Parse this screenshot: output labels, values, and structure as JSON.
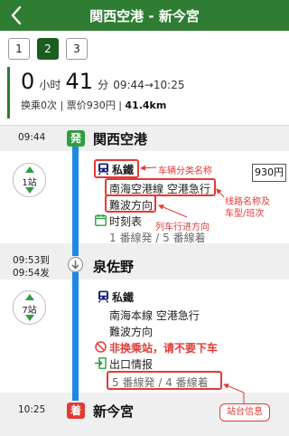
{
  "header": {
    "title": "関西空港 - 新今宮",
    "back_icon": "chevron-left-icon"
  },
  "route_pages": [
    {
      "label": "1",
      "selected": false
    },
    {
      "label": "2",
      "selected": true
    },
    {
      "label": "3",
      "selected": false
    }
  ],
  "summary": {
    "hours": "0",
    "hours_unit": "小时",
    "minutes": "41",
    "minutes_unit": "分",
    "depart_time": "09:44",
    "arrow": "→",
    "arrive_time": "10:25",
    "transfers": "换乘0次",
    "sep1": " | ",
    "fare": "票价930円",
    "sep2": " | ",
    "distance": "41.4km"
  },
  "stations": {
    "origin": {
      "time": "09:44",
      "badge": "発",
      "name": "関西空港"
    },
    "middle": {
      "time_arr": "09:53到",
      "time_dep": "09:54发",
      "name": "泉佐野"
    },
    "dest": {
      "time": "10:25",
      "badge": "着",
      "name": "新今宮"
    }
  },
  "segment1": {
    "stops": "1站",
    "category": "私鐵",
    "line_name": "南海空港線 空港急行",
    "direction": "難波方向",
    "timetable": "时刻表",
    "platform": "1 番線発 / 5 番線着",
    "fare": "930円"
  },
  "segment2": {
    "stops": "7站",
    "category": "私鐵",
    "line_name": "南海本線 空港急行",
    "direction": "難波方向",
    "no_transfer": "非换乘站，请不要下车",
    "exit_info": "出口情报",
    "platform": "5 番線発 / 4 番線着"
  },
  "annotations": {
    "category": "车辆分类名称",
    "line_name_1": "线路名称及",
    "line_name_2": "车型/班次",
    "direction": "列车行进方向",
    "platform": "站台信息"
  },
  "colors": {
    "header": "#2e7d32",
    "selected_page": "#1b5e20",
    "route_line": "#1e88e5",
    "depart_badge": "#2e9e3f",
    "arrive_badge": "#e53935",
    "annotation": "#e53935"
  }
}
